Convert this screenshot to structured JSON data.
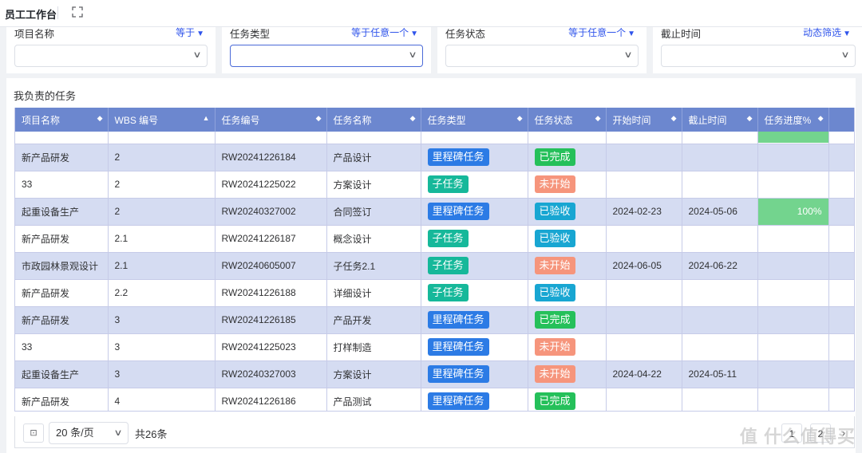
{
  "header": {
    "title": "员工工作台",
    "expand_icon": "expand-icon"
  },
  "filters": [
    {
      "label": "项目名称",
      "operator": "等于",
      "value": ""
    },
    {
      "label": "任务类型",
      "operator": "等于任意一个",
      "value": ""
    },
    {
      "label": "任务状态",
      "operator": "等于任意一个",
      "value": ""
    },
    {
      "label": "截止时间",
      "operator": "动态筛选",
      "value": ""
    }
  ],
  "section_title": "我负责的任务",
  "table": {
    "columns": [
      "项目名称",
      "WBS 编号",
      "任务编号",
      "任务名称",
      "任务类型",
      "任务状态",
      "开始时间",
      "截止时间",
      "任务进度%"
    ],
    "rows": [
      {
        "project": "新产品研发",
        "wbs": "2",
        "code": "RW20241226184",
        "name": "产品设计",
        "type": "里程碑任务",
        "status": "已完成",
        "start": "",
        "end": "",
        "progress": ""
      },
      {
        "project": "33",
        "wbs": "2",
        "code": "RW20241225022",
        "name": "方案设计",
        "type": "子任务",
        "status": "未开始",
        "start": "",
        "end": "",
        "progress": ""
      },
      {
        "project": "起重设备生产",
        "wbs": "2",
        "code": "RW20240327002",
        "name": "合同签订",
        "type": "里程碑任务",
        "status": "已验收",
        "start": "2024-02-23",
        "end": "2024-05-06",
        "progress": "100%"
      },
      {
        "project": "新产品研发",
        "wbs": "2.1",
        "code": "RW20241226187",
        "name": "概念设计",
        "type": "子任务",
        "status": "已验收",
        "start": "",
        "end": "",
        "progress": ""
      },
      {
        "project": "市政园林景观设计",
        "wbs": "2.1",
        "code": "RW20240605007",
        "name": "子任务2.1",
        "type": "子任务",
        "status": "未开始",
        "start": "2024-06-05",
        "end": "2024-06-22",
        "progress": ""
      },
      {
        "project": "新产品研发",
        "wbs": "2.2",
        "code": "RW20241226188",
        "name": "详细设计",
        "type": "子任务",
        "status": "已验收",
        "start": "",
        "end": "",
        "progress": ""
      },
      {
        "project": "新产品研发",
        "wbs": "3",
        "code": "RW20241226185",
        "name": "产品开发",
        "type": "里程碑任务",
        "status": "已完成",
        "start": "",
        "end": "",
        "progress": ""
      },
      {
        "project": "33",
        "wbs": "3",
        "code": "RW20241225023",
        "name": "打样制造",
        "type": "里程碑任务",
        "status": "未开始",
        "start": "",
        "end": "",
        "progress": ""
      },
      {
        "project": "起重设备生产",
        "wbs": "3",
        "code": "RW20240327003",
        "name": "方案设计",
        "type": "里程碑任务",
        "status": "未开始",
        "start": "2024-04-22",
        "end": "2024-05-11",
        "progress": ""
      },
      {
        "project": "新产品研发",
        "wbs": "4",
        "code": "RW20241226186",
        "name": "产品测试",
        "type": "里程碑任务",
        "status": "已完成",
        "start": "",
        "end": "",
        "progress": ""
      }
    ]
  },
  "pager": {
    "page_size": "20 条/页",
    "total": "共26条",
    "current_page": "1",
    "next_page": "2"
  },
  "watermark": "值 什么值得买",
  "colors": {
    "header_bg": "#6c87cf",
    "alt_row": "#d5dcf2",
    "tag_blue": "#2c7be5",
    "tag_teal": "#16b89a",
    "tag_cyan": "#18a6d2",
    "tag_green": "#25c05a",
    "tag_salmon": "#f6957c",
    "progress": "#73d48e"
  }
}
